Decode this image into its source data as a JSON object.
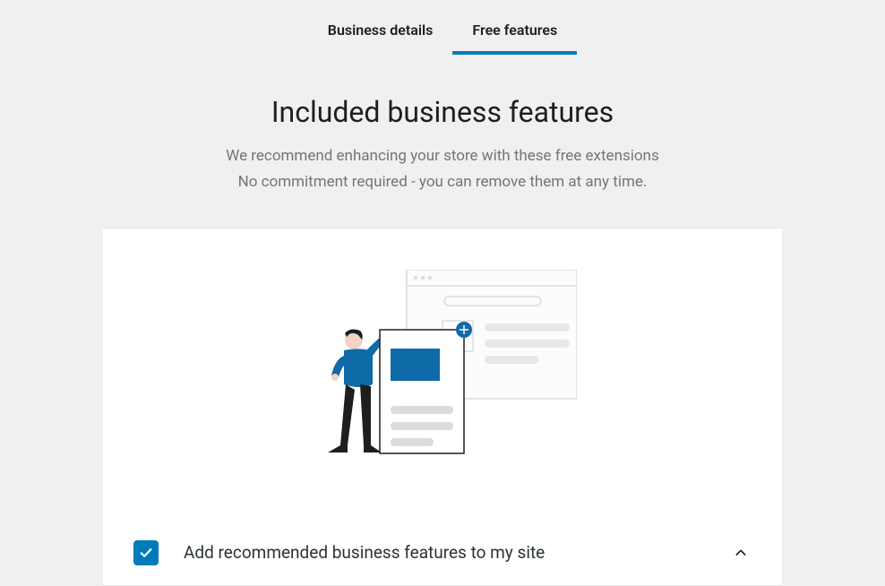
{
  "tabs": {
    "business_details": "Business details",
    "free_features": "Free features"
  },
  "header": {
    "title": "Included business features",
    "subtitle_line1": "We recommend enhancing your store with these free extensions",
    "subtitle_line2": "No commitment required - you can remove them at any time."
  },
  "accordion": {
    "checkbox_checked": true,
    "label": "Add recommended business features to my site"
  },
  "colors": {
    "accent": "#007cba",
    "text": "#1e1e1e",
    "muted": "#757575"
  }
}
